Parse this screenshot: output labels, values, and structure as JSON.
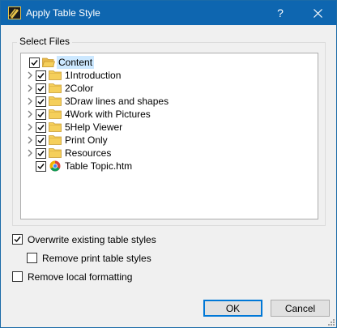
{
  "window": {
    "title": "Apply Table Style",
    "help_glyph": "?",
    "close_glyph": "✕"
  },
  "group": {
    "label": "Select Files"
  },
  "tree": {
    "items": [
      {
        "label": "Content",
        "checked": true,
        "expander": false,
        "icon": "folder-open-icon",
        "selected": true
      },
      {
        "label": "1Introduction",
        "checked": true,
        "expander": true,
        "icon": "folder-icon"
      },
      {
        "label": "2Color",
        "checked": true,
        "expander": true,
        "icon": "folder-icon"
      },
      {
        "label": "3Draw lines and shapes",
        "checked": true,
        "expander": true,
        "icon": "folder-icon"
      },
      {
        "label": "4Work with Pictures",
        "checked": true,
        "expander": true,
        "icon": "folder-icon"
      },
      {
        "label": "5Help Viewer",
        "checked": true,
        "expander": true,
        "icon": "folder-icon"
      },
      {
        "label": "Print Only",
        "checked": true,
        "expander": true,
        "icon": "folder-icon"
      },
      {
        "label": "Resources",
        "checked": true,
        "expander": true,
        "icon": "folder-icon"
      },
      {
        "label": "Table Topic.htm",
        "checked": true,
        "expander": false,
        "icon": "chrome-icon"
      }
    ]
  },
  "options": {
    "overwrite": {
      "label": "Overwrite existing table styles",
      "checked": true
    },
    "remove_print": {
      "label": "Remove print table styles",
      "checked": false
    },
    "remove_local": {
      "label": "Remove local formatting",
      "checked": false
    }
  },
  "buttons": {
    "ok": "OK",
    "cancel": "Cancel"
  },
  "colors": {
    "titlebar": "#0e66b0",
    "selection": "#cce8ff",
    "folder": "#f5cf5b"
  }
}
